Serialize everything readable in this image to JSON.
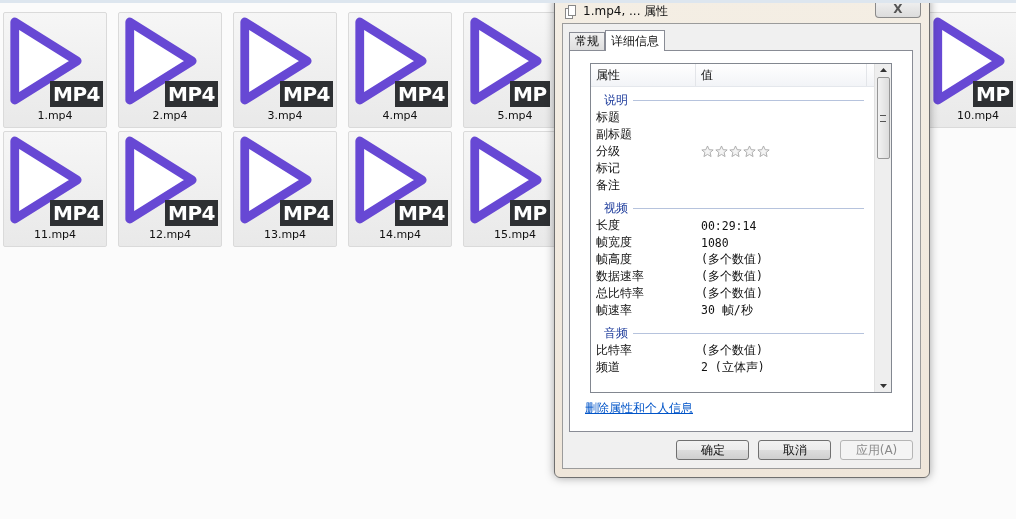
{
  "files": {
    "rows": [
      {
        "items": [
          {
            "name": "1.mp4",
            "badge": "MP4"
          },
          {
            "name": "2.mp4",
            "badge": "MP4"
          },
          {
            "name": "3.mp4",
            "badge": "MP4"
          },
          {
            "name": "4.mp4",
            "badge": "MP4"
          },
          {
            "name": "5.mp4",
            "badge": "MP"
          }
        ],
        "trailing_items": [
          {
            "name": "10.mp4",
            "badge": "MP"
          }
        ]
      },
      {
        "items": [
          {
            "name": "11.mp4",
            "badge": "MP4"
          },
          {
            "name": "12.mp4",
            "badge": "MP4"
          },
          {
            "name": "13.mp4",
            "badge": "MP4"
          },
          {
            "name": "14.mp4",
            "badge": "MP4"
          },
          {
            "name": "15.mp4",
            "badge": "MP"
          }
        ],
        "trailing_items": []
      }
    ]
  },
  "dialog": {
    "title": "1.mp4, ... 属性",
    "close": "X",
    "tabs": [
      {
        "label": "常规",
        "selected": false
      },
      {
        "label": "详细信息",
        "selected": true
      }
    ],
    "table": {
      "columns": [
        "属性",
        "值"
      ],
      "sections": [
        {
          "title": "说明",
          "rows": [
            {
              "kind": "text",
              "name": "标题"
            },
            {
              "kind": "text",
              "name": "副标题"
            },
            {
              "kind": "rating",
              "name": "分级",
              "stars": 0
            },
            {
              "kind": "text",
              "name": "标记"
            },
            {
              "kind": "text",
              "name": "备注"
            }
          ]
        },
        {
          "title": "视频",
          "rows": [
            {
              "kind": "text",
              "name": "长度",
              "value": "00:29:14"
            },
            {
              "kind": "text",
              "name": "帧宽度",
              "value": "1080"
            },
            {
              "kind": "text",
              "name": "帧高度",
              "value": "(多个数值)"
            },
            {
              "kind": "text",
              "name": "数据速率",
              "value": "(多个数值)"
            },
            {
              "kind": "text",
              "name": "总比特率",
              "value": "(多个数值)"
            },
            {
              "kind": "text",
              "name": "帧速率",
              "value": "30 帧/秒"
            }
          ]
        },
        {
          "title": "音频",
          "rows": [
            {
              "kind": "text",
              "name": "比特率",
              "value": "(多个数值)"
            },
            {
              "kind": "text",
              "name": "频道",
              "value": "2 (立体声)"
            }
          ]
        }
      ]
    },
    "link": "删除属性和个人信息",
    "buttons": [
      {
        "label": "确定",
        "disabled": false
      },
      {
        "label": "取消",
        "disabled": false
      },
      {
        "label": "应用(A)",
        "disabled": true
      }
    ]
  }
}
